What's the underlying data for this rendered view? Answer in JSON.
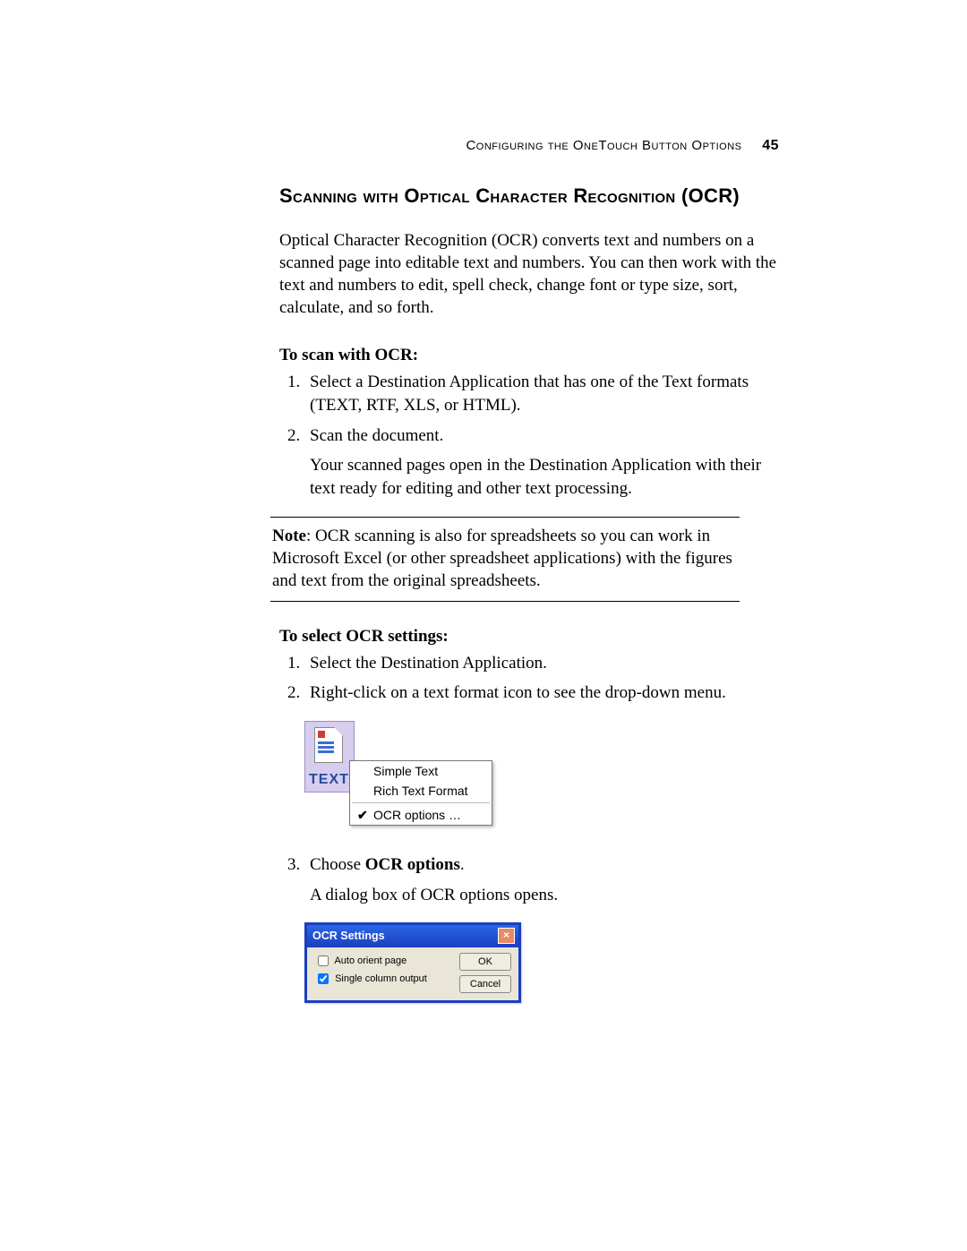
{
  "header": {
    "running_title": "Configuring the OneTouch Button Options",
    "page_number": "45"
  },
  "section": {
    "title": "Scanning with Optical Character Recognition (OCR)",
    "intro": "Optical Character Recognition (OCR) converts text and numbers on a scanned page into editable text and numbers. You can then work with the text and numbers to edit, spell check, change font or type size, sort, calculate, and so forth."
  },
  "scan_block": {
    "heading": "To scan with OCR:",
    "steps": [
      "Select a Destination Application that has one of the Text formats (TEXT, RTF, XLS, or HTML).",
      "Scan the document."
    ],
    "step2_followup": "Your scanned pages open in the Destination Application with their text ready for editing and other text processing."
  },
  "note": {
    "label": "Note",
    "text": ":  OCR scanning is also for spreadsheets so you can work in Microsoft Excel (or other spreadsheet applications) with the figures and text from the original spreadsheets."
  },
  "select_block": {
    "heading": "To select OCR settings:",
    "steps": [
      "Select the Destination Application.",
      "Right-click on a text format icon to see the drop-down menu."
    ]
  },
  "text_icon": {
    "label": "TEXT"
  },
  "context_menu": {
    "items": [
      "Simple Text",
      "Rich Text Format"
    ],
    "ocr_item": "OCR options …"
  },
  "step3": {
    "prefix": "Choose ",
    "bold": "OCR options",
    "suffix": ".",
    "followup": "A dialog box of OCR options opens."
  },
  "ocr_dialog": {
    "title": "OCR Settings",
    "option1": "Auto orient page",
    "option2": "Single column output",
    "option1_checked": false,
    "option2_checked": true,
    "ok": "OK",
    "cancel": "Cancel"
  }
}
